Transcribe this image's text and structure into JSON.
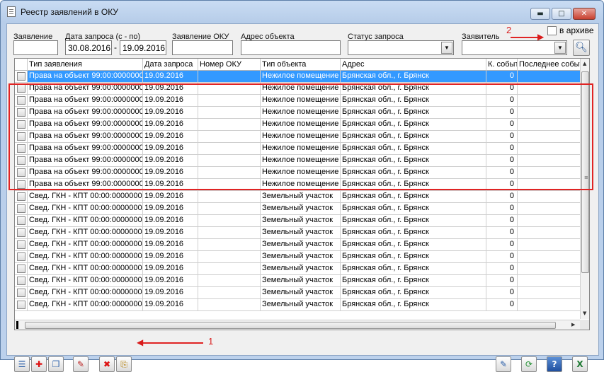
{
  "window": {
    "title": "Реестр заявлений в ОКУ",
    "minimize_glyph": "▬",
    "maximize_glyph": "□",
    "close_glyph": "✕"
  },
  "filters": {
    "application_label": "Заявление",
    "application_value": "",
    "request_date_label": "Дата запроса (с - по)",
    "date_from": "30.08.2016",
    "date_to": "19.09.2016",
    "oku_label": "Заявление ОКУ",
    "oku_value": "",
    "address_label": "Адрес объекта",
    "address_value": "",
    "status_label": "Статус запроса",
    "status_value": "",
    "applicant_label": "Заявитель",
    "applicant_value": "",
    "archive_label": "в архиве"
  },
  "grid": {
    "columns": [
      "Тип заявления",
      "Дата запроса",
      "Номер ОКУ",
      "Тип объекта",
      "Адрес",
      "К. событ",
      "Последнее событ"
    ],
    "rows": [
      {
        "type": "Права на объект 99:00:0000000",
        "date": "19.09.2016",
        "oku": "",
        "object": "Нежилое помещение",
        "address": "Брянская обл., г. Брянск",
        "count": "0",
        "last": "",
        "selected": true
      },
      {
        "type": "Права на объект 99:00:0000000",
        "date": "19.09.2016",
        "oku": "",
        "object": "Нежилое помещение",
        "address": "Брянская обл., г. Брянск",
        "count": "0",
        "last": ""
      },
      {
        "type": "Права на объект 99:00:0000000",
        "date": "19.09.2016",
        "oku": "",
        "object": "Нежилое помещение",
        "address": "Брянская обл., г. Брянск",
        "count": "0",
        "last": ""
      },
      {
        "type": "Права на объект 99:00:0000000",
        "date": "19.09.2016",
        "oku": "",
        "object": "Нежилое помещение",
        "address": "Брянская обл., г. Брянск",
        "count": "0",
        "last": ""
      },
      {
        "type": "Права на объект 99:00:0000000",
        "date": "19.09.2016",
        "oku": "",
        "object": "Нежилое помещение",
        "address": "Брянская обл., г. Брянск",
        "count": "0",
        "last": ""
      },
      {
        "type": "Права на объект 99:00:0000000",
        "date": "19.09.2016",
        "oku": "",
        "object": "Нежилое помещение",
        "address": "Брянская обл., г. Брянск",
        "count": "0",
        "last": ""
      },
      {
        "type": "Права на объект 99:00:0000000",
        "date": "19.09.2016",
        "oku": "",
        "object": "Нежилое помещение",
        "address": "Брянская обл., г. Брянск",
        "count": "0",
        "last": ""
      },
      {
        "type": "Права на объект 99:00:0000000",
        "date": "19.09.2016",
        "oku": "",
        "object": "Нежилое помещение",
        "address": "Брянская обл., г. Брянск",
        "count": "0",
        "last": ""
      },
      {
        "type": "Права на объект 99:00:0000000",
        "date": "19.09.2016",
        "oku": "",
        "object": "Нежилое помещение",
        "address": "Брянская обл., г. Брянск",
        "count": "0",
        "last": ""
      },
      {
        "type": "Права на объект 99:00:0000000",
        "date": "19.09.2016",
        "oku": "",
        "object": "Нежилое помещение",
        "address": "Брянская обл., г. Брянск",
        "count": "0",
        "last": ""
      },
      {
        "type": "Свед. ГКН - КПТ 00:00:0000000",
        "date": "19.09.2016",
        "oku": "",
        "object": "Земельный участок",
        "address": "Брянская обл., г. Брянск",
        "count": "0",
        "last": ""
      },
      {
        "type": "Свед. ГКН - КПТ 00:00:0000000",
        "date": "19.09.2016",
        "oku": "",
        "object": "Земельный участок",
        "address": "Брянская обл., г. Брянск",
        "count": "0",
        "last": ""
      },
      {
        "type": "Свед. ГКН - КПТ 00:00:0000000",
        "date": "19.09.2016",
        "oku": "",
        "object": "Земельный участок",
        "address": "Брянская обл., г. Брянск",
        "count": "0",
        "last": ""
      },
      {
        "type": "Свед. ГКН - КПТ 00:00:0000000",
        "date": "19.09.2016",
        "oku": "",
        "object": "Земельный участок",
        "address": "Брянская обл., г. Брянск",
        "count": "0",
        "last": ""
      },
      {
        "type": "Свед. ГКН - КПТ 00:00:0000000",
        "date": "19.09.2016",
        "oku": "",
        "object": "Земельный участок",
        "address": "Брянская обл., г. Брянск",
        "count": "0",
        "last": ""
      },
      {
        "type": "Свед. ГКН - КПТ 00:00:0000000",
        "date": "19.09.2016",
        "oku": "",
        "object": "Земельный участок",
        "address": "Брянская обл., г. Брянск",
        "count": "0",
        "last": ""
      },
      {
        "type": "Свед. ГКН - КПТ 00:00:0000000",
        "date": "19.09.2016",
        "oku": "",
        "object": "Земельный участок",
        "address": "Брянская обл., г. Брянск",
        "count": "0",
        "last": ""
      },
      {
        "type": "Свед. ГКН - КПТ 00:00:0000000",
        "date": "19.09.2016",
        "oku": "",
        "object": "Земельный участок",
        "address": "Брянская обл., г. Брянск",
        "count": "0",
        "last": ""
      },
      {
        "type": "Свед. ГКН - КПТ 00:00:0000000",
        "date": "19.09.2016",
        "oku": "",
        "object": "Земельный участок",
        "address": "Брянская обл., г. Брянск",
        "count": "0",
        "last": ""
      },
      {
        "type": "Свед. ГКН - КПТ 00:00:0000000",
        "date": "19.09.2016",
        "oku": "",
        "object": "Земельный участок",
        "address": "Брянская обл., г. Брянск",
        "count": "0",
        "last": ""
      }
    ]
  },
  "annotations": {
    "marker_1": "1",
    "marker_2": "2",
    "color": "#e02424"
  },
  "toolbar": {
    "left_icons": [
      "list-icon",
      "add-icon",
      "copy-icon",
      "edit-pencil-icon",
      "delete-icon",
      "archive-icon"
    ],
    "right_icons": [
      "edit-document-icon",
      "refresh-icon",
      "help-icon",
      "excel-icon"
    ],
    "glyphs": {
      "list": "☰",
      "add": "✚",
      "copy": "❐",
      "edit_pencil": "✎",
      "delete": "✖",
      "archive": "⎘",
      "edit_document": "✎",
      "refresh": "⟳",
      "help": "?",
      "excel": "X"
    }
  },
  "colors": {
    "selection": "#3399ff",
    "accent_red": "#e02424"
  }
}
